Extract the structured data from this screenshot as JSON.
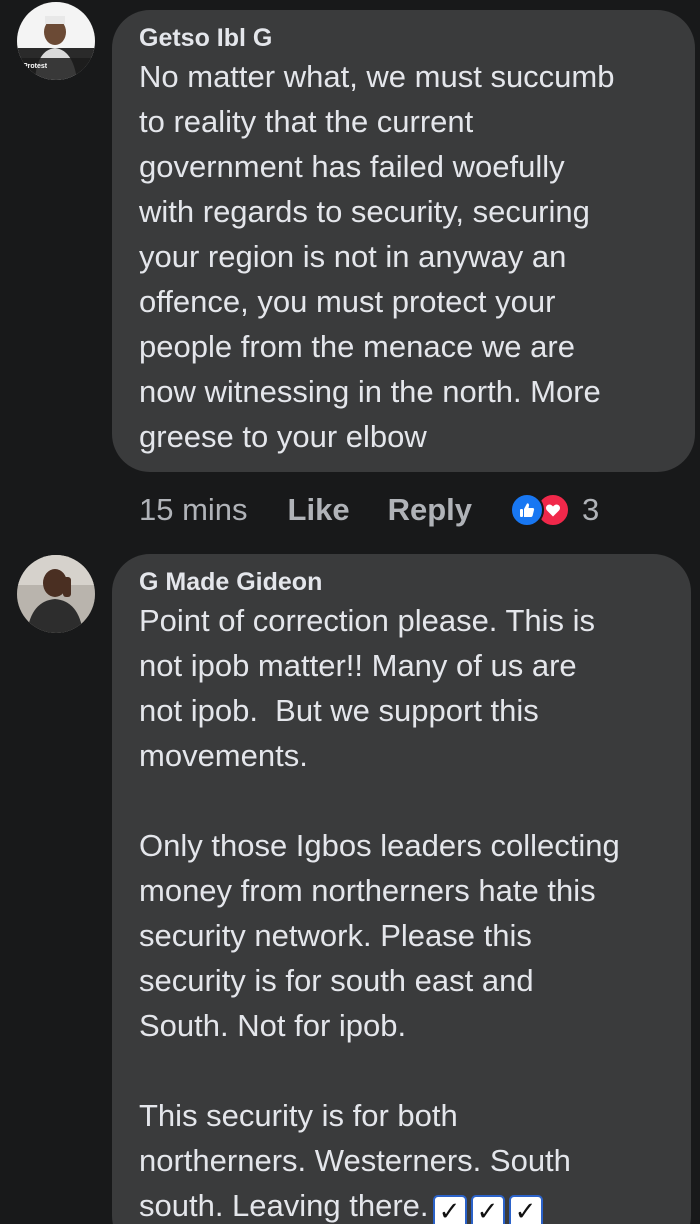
{
  "comments": [
    {
      "author": "Getso Ibl G",
      "avatar_overlay_text": "Protest",
      "text": "No matter what, we must succumb\nto reality that the current\ngovernment has failed woefully\nwith regards to security, securing\nyour region is not in anyway an\noffence, you must protect your\npeople from the menace we are\nnow witnessing in the north. More\ngreese to your elbow",
      "time": "15 mins",
      "like_label": "Like",
      "reply_label": "Reply",
      "reaction_icons": [
        "like-icon",
        "love-icon"
      ],
      "reaction_count": "3"
    },
    {
      "author": "G Made Gideon",
      "text": "Point of correction please. This is\nnot ipob matter!! Many of us are\nnot ipob.  But we support this\nmovements.\n\nOnly those Igbos leaders collecting\nmoney from northerners hate this\nsecurity network. Please this\nsecurity is for south east and\nSouth. Not for ipob.\n\nThis security is for both\nnortherners. Westerners. South\nsouth. Leaving there.",
      "trailing_emoji": [
        "check-mark-button",
        "check-mark-button",
        "check-mark-button"
      ],
      "check_glyph": "✓"
    }
  ],
  "colors": {
    "background": "#18191a",
    "bubble": "#3a3b3c",
    "text": "#e4e6eb",
    "meta": "#b0b3b8",
    "like_reaction": "#1877f2",
    "love_reaction": "#f0284a"
  }
}
